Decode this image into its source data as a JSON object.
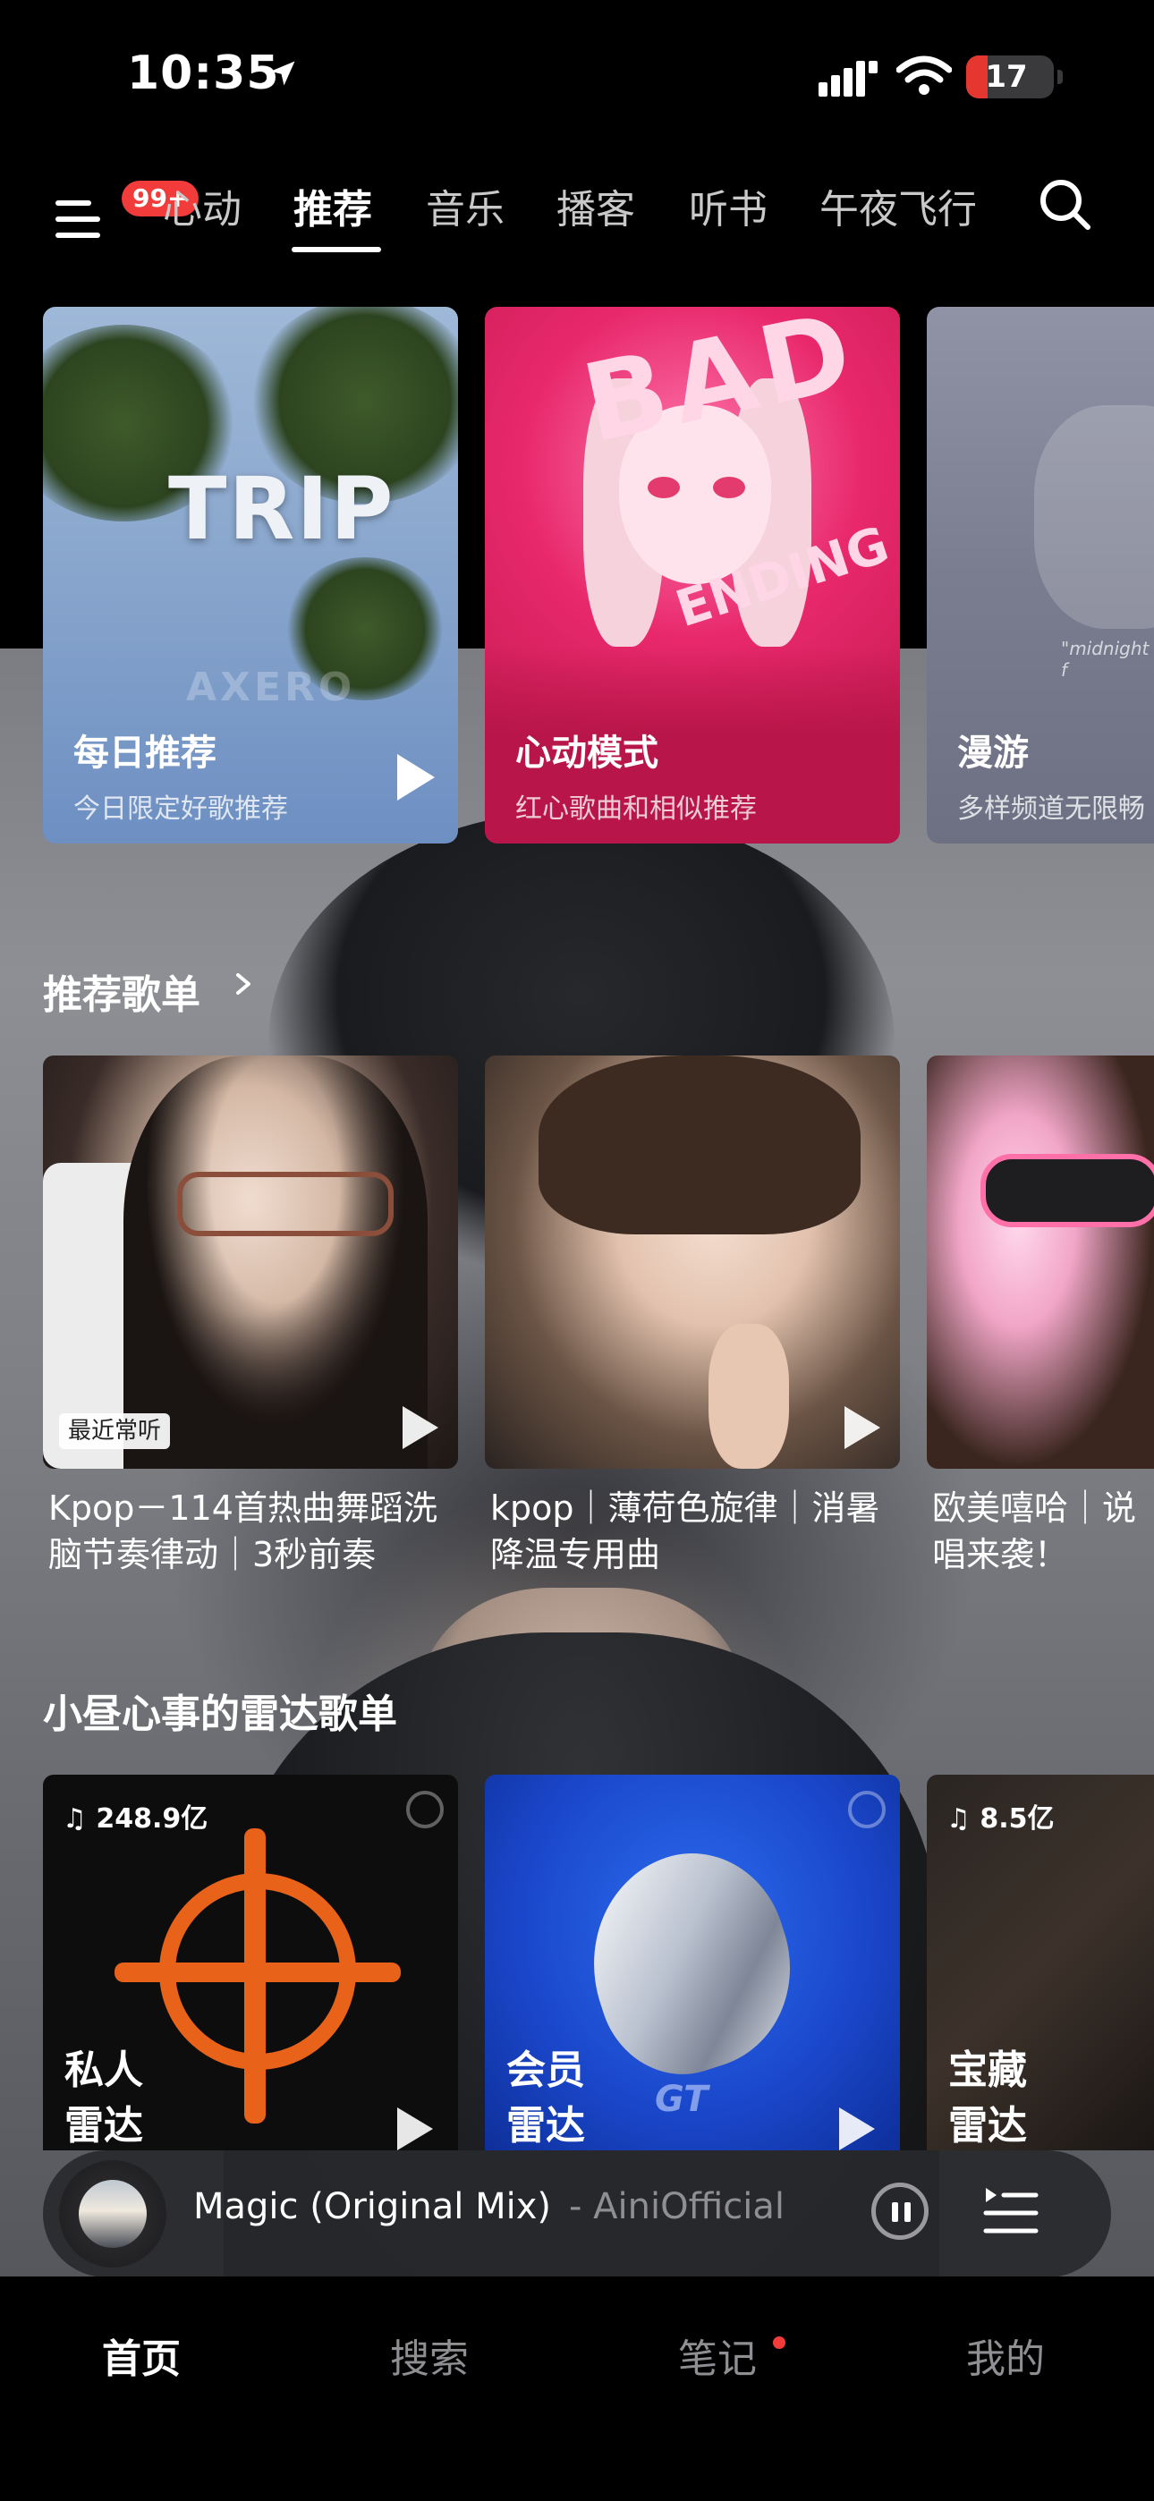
{
  "status_bar": {
    "time": "10:35",
    "battery": "17"
  },
  "top_nav": {
    "badge": "99+",
    "tabs": [
      {
        "label": "心动"
      },
      {
        "label": "推荐"
      },
      {
        "label": "音乐"
      },
      {
        "label": "播客"
      },
      {
        "label": "听书"
      },
      {
        "label": "午夜飞行"
      }
    ],
    "active_tab": "推荐"
  },
  "feature_cards": [
    {
      "title": "每日推荐",
      "subtitle": "今日限定好歌推荐",
      "art_text": "TRIP",
      "art_brand": "AXERO"
    },
    {
      "title": "心动模式",
      "subtitle": "红心歌曲和相似推荐",
      "art_text": "BAD",
      "art_text_2": "ENDING"
    },
    {
      "title": "漫游",
      "subtitle": "多样频道无限畅",
      "art_text": "\"midnight f"
    }
  ],
  "recommended": {
    "heading": "推荐歌单",
    "playlists": [
      {
        "title": "Kpop－114首热曲舞蹈洗脑节奏律动｜3秒前奏",
        "tag": "最近常听"
      },
      {
        "title": "kpop｜薄荷色旋律｜消暑降温专用曲"
      },
      {
        "title": "欧美嘻哈｜说唱来袭！"
      }
    ]
  },
  "radar": {
    "heading": "小昼心事的雷达歌单",
    "cards": [
      {
        "count": "248.9亿",
        "label_line1": "私人",
        "label_line2": "雷达"
      },
      {
        "count": "",
        "label_line1": "会员",
        "label_line2": "雷达",
        "art_text": "GT"
      },
      {
        "count": "8.5亿",
        "label_line1": "宝藏",
        "label_line2": "雷达"
      }
    ]
  },
  "mini_player": {
    "song": "Magic (Original Mix)",
    "separator": "-",
    "artist": "AiniOfficial"
  },
  "bottom_nav": {
    "items": [
      {
        "label": "首页"
      },
      {
        "label": "搜索"
      },
      {
        "label": "笔记"
      },
      {
        "label": "我的"
      }
    ],
    "active": "首页"
  },
  "colors": {
    "accent_red": "#f23b3b",
    "background": "#000000"
  }
}
